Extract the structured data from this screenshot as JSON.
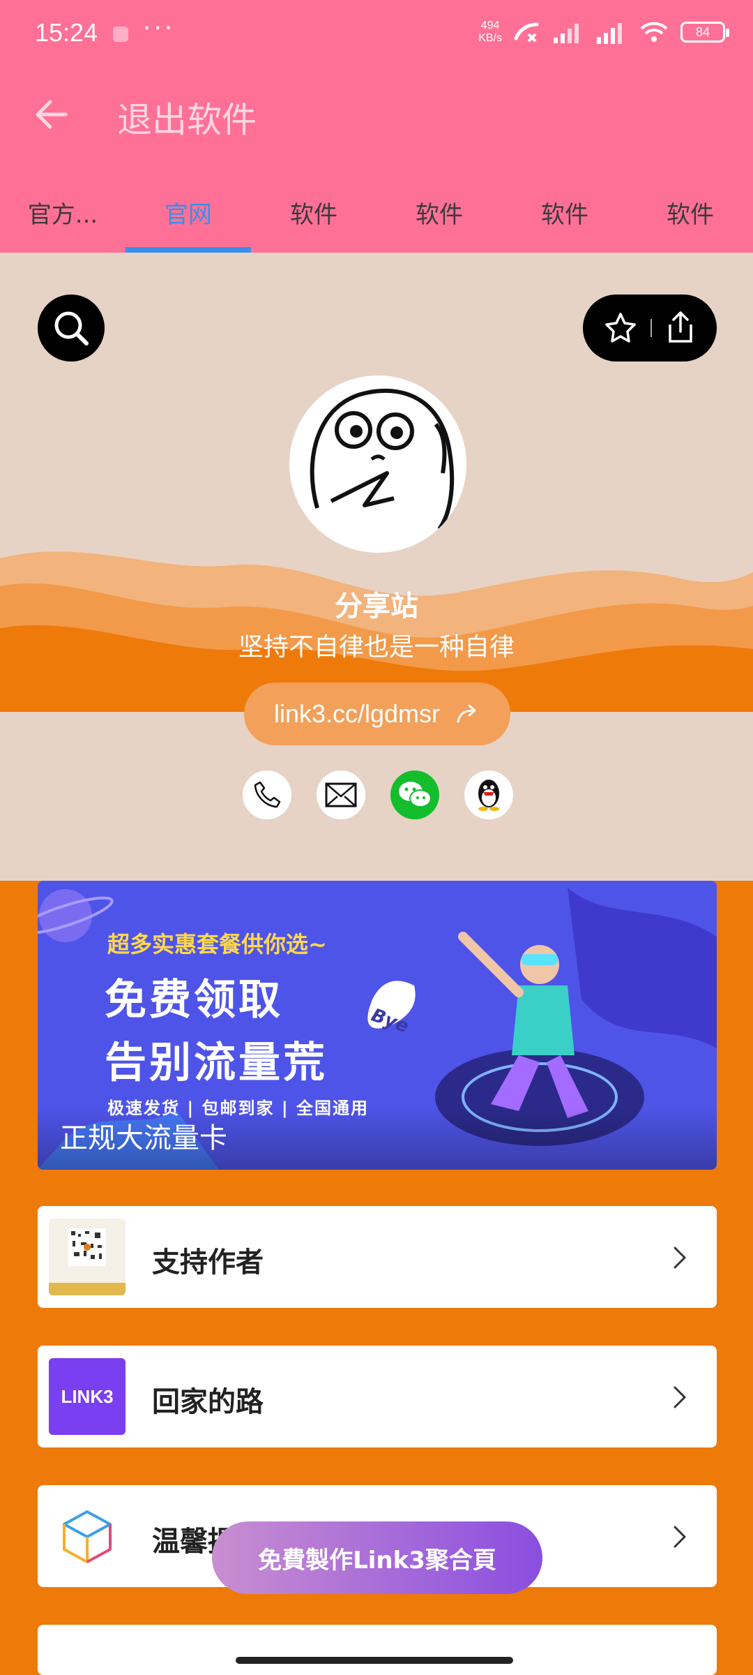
{
  "status_bar": {
    "time": "15:24",
    "speed_value": "494",
    "speed_unit": "KB/s",
    "battery": "84"
  },
  "app_bar": {
    "title": "退出软件"
  },
  "tabs": [
    {
      "label": "官方..."
    },
    {
      "label": "官网"
    },
    {
      "label": "软件"
    },
    {
      "label": "软件"
    },
    {
      "label": "软件"
    },
    {
      "label": "软件"
    }
  ],
  "profile": {
    "name": "分享站",
    "motto": "坚持不自律也是一种自律",
    "link": "link3.cc/lgdmsr"
  },
  "banner": {
    "line1": "超多实惠套餐供你选~",
    "line2": "免费领取",
    "line3": "告别流量荒",
    "line4": "极速发货 | 包邮到家 | 全国通用",
    "bye": "Bye",
    "caption": "正规大流量卡"
  },
  "cards": [
    {
      "label": "支持作者"
    },
    {
      "label": "回家的路",
      "thumb_text": "LINK3"
    },
    {
      "label": "温馨提"
    }
  ],
  "cta": {
    "label": "免費製作Link3聚合頁"
  },
  "colors": {
    "accent_pink": "#ff7097",
    "tab_active": "#3a8ee6",
    "page_orange": "#ee7a0a",
    "banner_blue": "#4e54e8"
  }
}
